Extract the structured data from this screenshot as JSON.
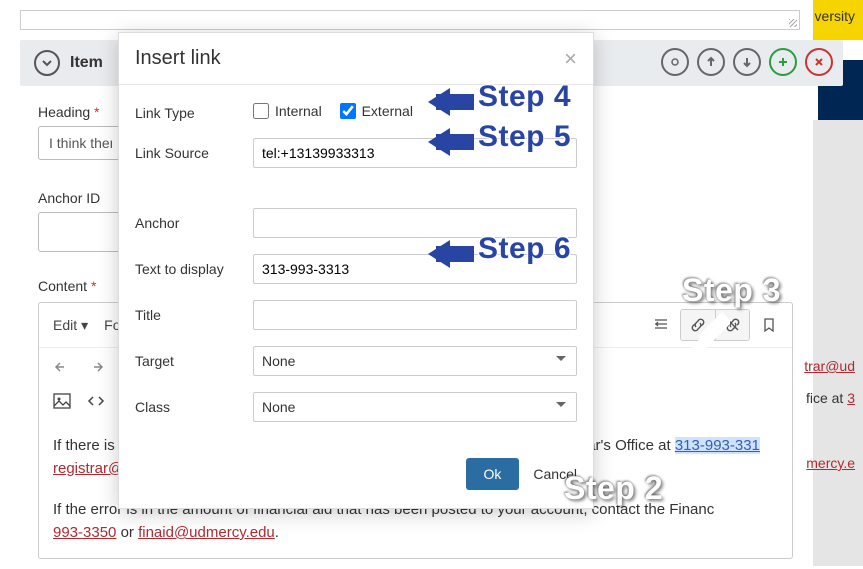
{
  "right_texts": {
    "versity": "versity",
    "trar_link": "trar@ud",
    "fice_at": "fice at ",
    "three_link": "3",
    "mercy_link": "mercy.e"
  },
  "item_bar": {
    "title": "Item"
  },
  "fields": {
    "heading_label": "Heading",
    "heading_value": "I think there",
    "anchor_label": "Anchor ID",
    "content_label": "Content"
  },
  "toolbar": {
    "edit": "Edit",
    "format": "For"
  },
  "editor": {
    "line1_a": "If there is a",
    "line1_b": "ar's Office at ",
    "line1_phone": "313-993-331",
    "line2_email": "registrar@udmercy.edu",
    "line2_dot": ".",
    "line3": "If the error is in the amount of financial aid that has been posted to your account, contact the Financ",
    "line4_phone": "993-3350",
    "line4_or": " or ",
    "line4_email": "finaid@udmercy.edu",
    "line4_dot": "."
  },
  "modal": {
    "title": "Insert link",
    "link_type_label": "Link Type",
    "internal_label": "Internal",
    "external_label": "External",
    "link_source_label": "Link Source",
    "link_source_value": "tel:+13139933313",
    "anchor_label": "Anchor",
    "text_display_label": "Text to display",
    "text_display_value": "313-993-3313",
    "title_label": "Title",
    "target_label": "Target",
    "target_value": "None",
    "class_label": "Class",
    "class_value": "None",
    "ok": "Ok",
    "cancel": "Cancel"
  },
  "steps": {
    "s2": "Step 2",
    "s3": "Step 3",
    "s4": "Step 4",
    "s5": "Step 5",
    "s6": "Step 6"
  }
}
